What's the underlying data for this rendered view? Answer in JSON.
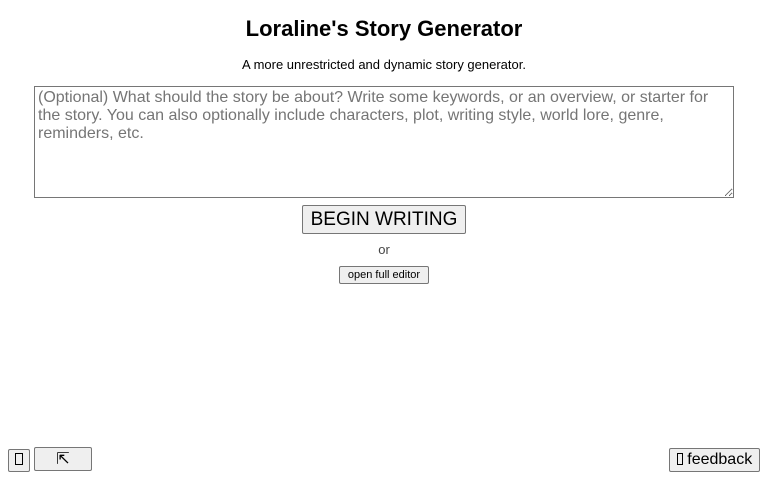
{
  "header": {
    "title": "Loraline's Story Generator",
    "subtitle": "A more unrestricted and dynamic story generator."
  },
  "prompt_input": {
    "value": "",
    "placeholder": "(Optional) What should the story be about? Write some keywords, or an overview, or starter for the story. You can also optionally include characters, plot, writing style, world lore, genre, reminders, etc."
  },
  "actions": {
    "begin_label": "BEGIN WRITING",
    "or_text": "or",
    "editor_label": "open full editor"
  },
  "footer": {
    "menu_icon": "menu-icon",
    "expand_icon": "expand-arrow-icon",
    "expand_glyph": "⇱",
    "feedback_icon": "feedback-icon",
    "feedback_label": "feedback"
  }
}
